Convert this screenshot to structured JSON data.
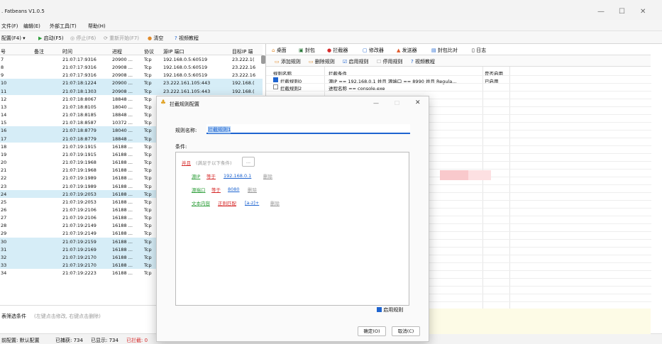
{
  "app": {
    "title": ". Fatbeans V1.0.5",
    "min": "—",
    "max": "☐",
    "close": "✕"
  },
  "menu": [
    "文件(F)",
    "编辑(E)",
    "外部工具(T)",
    "帮助(H)"
  ],
  "toolbar": {
    "config": "配置(F4)",
    "start": "启动(F5)",
    "stop": "停止(F6)",
    "restart": "重新开始(F7)",
    "clear": "清空",
    "video": "视频教程"
  },
  "table": {
    "headers": [
      "号",
      "备注",
      "时间",
      "进程",
      "协议",
      "源IP 端口",
      "目标IP 端"
    ],
    "rows": [
      [
        "7",
        "",
        "21:07:17:9316",
        "20900 ...",
        "Tcp",
        "192.168.0.5:60519",
        "23.222.1("
      ],
      [
        "8",
        "",
        "21:07:17:9316",
        "20908 ...",
        "Tcp",
        "192.168.0.5:60519",
        "23.222.16"
      ],
      [
        "9",
        "",
        "21:07:17:9316",
        "20908 ...",
        "Tcp",
        "192.168.0.5:60519",
        "23.222.16"
      ],
      [
        "10",
        "",
        "21:07:18:1224",
        "20900 ...",
        "Tcp",
        "23.222.161.105:443",
        "192.168.("
      ],
      [
        "11",
        "",
        "21:07:18:1303",
        "20908 ...",
        "Tcp",
        "23.222.161.105:443",
        "192.168.("
      ],
      [
        "12",
        "",
        "21:07:18:8067",
        "18848 ...",
        "Tcp",
        "",
        ""
      ],
      [
        "13",
        "",
        "21:07:18:8105",
        "18040 ...",
        "Tcp",
        "",
        ""
      ],
      [
        "14",
        "",
        "21:07:18:8185",
        "18848 ...",
        "Tcp",
        "",
        ""
      ],
      [
        "15",
        "",
        "21:07:18:8587",
        "10372 ...",
        "Tcp",
        "",
        ""
      ],
      [
        "16",
        "",
        "21:07:18:8779",
        "18040 ...",
        "Tcp",
        "",
        ""
      ],
      [
        "17",
        "",
        "21:07:18:8779",
        "18848 ...",
        "Tcp",
        "",
        ""
      ],
      [
        "18",
        "",
        "21:07:19:1915",
        "16188 ...",
        "Tcp",
        "",
        ""
      ],
      [
        "19",
        "",
        "21:07:19:1915",
        "16188 ...",
        "Tcp",
        "",
        ""
      ],
      [
        "20",
        "",
        "21:07:19:1968",
        "16188 ...",
        "Tcp",
        "",
        ""
      ],
      [
        "21",
        "",
        "21:07:19:1968",
        "16188 ...",
        "Tcp",
        "",
        ""
      ],
      [
        "22",
        "",
        "21:07:19:1989",
        "16188 ...",
        "Tcp",
        "",
        ""
      ],
      [
        "23",
        "",
        "21:07:19:1989",
        "16188 ...",
        "Tcp",
        "",
        ""
      ],
      [
        "24",
        "",
        "21:07:19:2053",
        "16188 ...",
        "Tcp",
        "",
        ""
      ],
      [
        "25",
        "",
        "21:07:19:2053",
        "16188 ...",
        "Tcp",
        "",
        ""
      ],
      [
        "26",
        "",
        "21:07:19:2106",
        "16188 ...",
        "Tcp",
        "",
        ""
      ],
      [
        "27",
        "",
        "21:07:19:2106",
        "16188 ...",
        "Tcp",
        "",
        ""
      ],
      [
        "28",
        "",
        "21:07:19:2149",
        "16188 ...",
        "Tcp",
        "",
        ""
      ],
      [
        "29",
        "",
        "21:07:19:2149",
        "16188 ...",
        "Tcp",
        "",
        ""
      ],
      [
        "30",
        "",
        "21:07:19:2159",
        "16188 ...",
        "Tcp",
        "",
        ""
      ],
      [
        "31",
        "",
        "21:07:19:2169",
        "16188 ...",
        "Tcp",
        "",
        ""
      ],
      [
        "32",
        "",
        "21:07:19:2170",
        "16188 ...",
        "Tcp",
        "",
        ""
      ],
      [
        "33",
        "",
        "21:07:19:2170",
        "16188 ...",
        "Tcp",
        "",
        ""
      ],
      [
        "34",
        "",
        "21:07:19:2223",
        "16188 ...",
        "Tcp",
        "",
        ""
      ]
    ]
  },
  "filter": {
    "label": "表筛选条件",
    "hint": "(左键点击修改, 右键点击删除)"
  },
  "status": {
    "config": "前配置: 默认配置",
    "captured": "已捕获: 734",
    "shown": "已显示: 734",
    "intercepted": "已拦截: 0"
  },
  "rtabs": [
    "桌面",
    "封包",
    "拦截器",
    "修改器",
    "发送器",
    "封包比对",
    "日志"
  ],
  "rtool": [
    "添加规则",
    "删除规则",
    "启用规则",
    "停用规则",
    "视频教程"
  ],
  "rules": {
    "headers": [
      "规则名称",
      "拦截条件",
      "是否启用"
    ],
    "rows": [
      {
        "name": "拦截规则0",
        "cond": "源IP == 192.168.0.1 并且 源端口 == 8990 并且 Regula...",
        "enabled": "已启用",
        "checked": true
      },
      {
        "name": "拦截规则2",
        "cond": "进程名称 == console.exe",
        "enabled": "",
        "checked": false
      }
    ]
  },
  "dialog": {
    "title": "拦截规则配置",
    "name_label": "规则名称:",
    "name_value": "拦截规则1",
    "cond_label": "条件:",
    "group_op": "并且",
    "group_hint": "(满足于以下条件)",
    "more": "...",
    "conds": [
      {
        "field": "源IP",
        "op": "等于",
        "value": "192.168.0.1",
        "del": "删除"
      },
      {
        "field": "源端口",
        "op": "等于",
        "value": "8080",
        "del": "删除"
      },
      {
        "field": "文本内容",
        "op": "正则匹配",
        "value": "[a-z]+",
        "del": "删除"
      }
    ],
    "enable": "启用规则",
    "ok": "确定(O)",
    "cancel": "取消(C)",
    "min": "—",
    "max": "☐",
    "close": "✕"
  }
}
